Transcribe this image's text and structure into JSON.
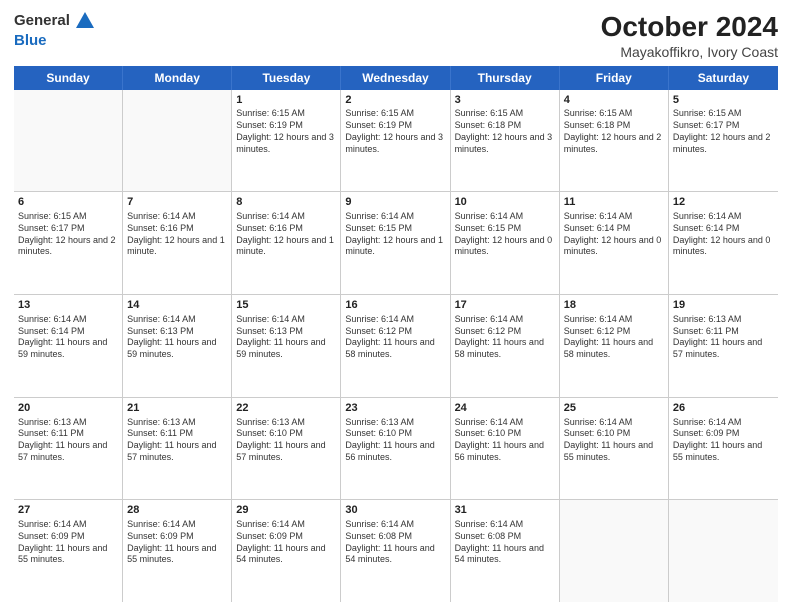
{
  "logo": {
    "general": "General",
    "blue": "Blue"
  },
  "title": "October 2024",
  "subtitle": "Mayakoffikro, Ivory Coast",
  "header_days": [
    "Sunday",
    "Monday",
    "Tuesday",
    "Wednesday",
    "Thursday",
    "Friday",
    "Saturday"
  ],
  "weeks": [
    [
      {
        "day": "",
        "sunrise": "",
        "sunset": "",
        "daylight": ""
      },
      {
        "day": "",
        "sunrise": "",
        "sunset": "",
        "daylight": ""
      },
      {
        "day": "1",
        "sunrise": "Sunrise: 6:15 AM",
        "sunset": "Sunset: 6:19 PM",
        "daylight": "Daylight: 12 hours and 3 minutes."
      },
      {
        "day": "2",
        "sunrise": "Sunrise: 6:15 AM",
        "sunset": "Sunset: 6:19 PM",
        "daylight": "Daylight: 12 hours and 3 minutes."
      },
      {
        "day": "3",
        "sunrise": "Sunrise: 6:15 AM",
        "sunset": "Sunset: 6:18 PM",
        "daylight": "Daylight: 12 hours and 3 minutes."
      },
      {
        "day": "4",
        "sunrise": "Sunrise: 6:15 AM",
        "sunset": "Sunset: 6:18 PM",
        "daylight": "Daylight: 12 hours and 2 minutes."
      },
      {
        "day": "5",
        "sunrise": "Sunrise: 6:15 AM",
        "sunset": "Sunset: 6:17 PM",
        "daylight": "Daylight: 12 hours and 2 minutes."
      }
    ],
    [
      {
        "day": "6",
        "sunrise": "Sunrise: 6:15 AM",
        "sunset": "Sunset: 6:17 PM",
        "daylight": "Daylight: 12 hours and 2 minutes."
      },
      {
        "day": "7",
        "sunrise": "Sunrise: 6:14 AM",
        "sunset": "Sunset: 6:16 PM",
        "daylight": "Daylight: 12 hours and 1 minute."
      },
      {
        "day": "8",
        "sunrise": "Sunrise: 6:14 AM",
        "sunset": "Sunset: 6:16 PM",
        "daylight": "Daylight: 12 hours and 1 minute."
      },
      {
        "day": "9",
        "sunrise": "Sunrise: 6:14 AM",
        "sunset": "Sunset: 6:15 PM",
        "daylight": "Daylight: 12 hours and 1 minute."
      },
      {
        "day": "10",
        "sunrise": "Sunrise: 6:14 AM",
        "sunset": "Sunset: 6:15 PM",
        "daylight": "Daylight: 12 hours and 0 minutes."
      },
      {
        "day": "11",
        "sunrise": "Sunrise: 6:14 AM",
        "sunset": "Sunset: 6:14 PM",
        "daylight": "Daylight: 12 hours and 0 minutes."
      },
      {
        "day": "12",
        "sunrise": "Sunrise: 6:14 AM",
        "sunset": "Sunset: 6:14 PM",
        "daylight": "Daylight: 12 hours and 0 minutes."
      }
    ],
    [
      {
        "day": "13",
        "sunrise": "Sunrise: 6:14 AM",
        "sunset": "Sunset: 6:14 PM",
        "daylight": "Daylight: 11 hours and 59 minutes."
      },
      {
        "day": "14",
        "sunrise": "Sunrise: 6:14 AM",
        "sunset": "Sunset: 6:13 PM",
        "daylight": "Daylight: 11 hours and 59 minutes."
      },
      {
        "day": "15",
        "sunrise": "Sunrise: 6:14 AM",
        "sunset": "Sunset: 6:13 PM",
        "daylight": "Daylight: 11 hours and 59 minutes."
      },
      {
        "day": "16",
        "sunrise": "Sunrise: 6:14 AM",
        "sunset": "Sunset: 6:12 PM",
        "daylight": "Daylight: 11 hours and 58 minutes."
      },
      {
        "day": "17",
        "sunrise": "Sunrise: 6:14 AM",
        "sunset": "Sunset: 6:12 PM",
        "daylight": "Daylight: 11 hours and 58 minutes."
      },
      {
        "day": "18",
        "sunrise": "Sunrise: 6:14 AM",
        "sunset": "Sunset: 6:12 PM",
        "daylight": "Daylight: 11 hours and 58 minutes."
      },
      {
        "day": "19",
        "sunrise": "Sunrise: 6:13 AM",
        "sunset": "Sunset: 6:11 PM",
        "daylight": "Daylight: 11 hours and 57 minutes."
      }
    ],
    [
      {
        "day": "20",
        "sunrise": "Sunrise: 6:13 AM",
        "sunset": "Sunset: 6:11 PM",
        "daylight": "Daylight: 11 hours and 57 minutes."
      },
      {
        "day": "21",
        "sunrise": "Sunrise: 6:13 AM",
        "sunset": "Sunset: 6:11 PM",
        "daylight": "Daylight: 11 hours and 57 minutes."
      },
      {
        "day": "22",
        "sunrise": "Sunrise: 6:13 AM",
        "sunset": "Sunset: 6:10 PM",
        "daylight": "Daylight: 11 hours and 57 minutes."
      },
      {
        "day": "23",
        "sunrise": "Sunrise: 6:13 AM",
        "sunset": "Sunset: 6:10 PM",
        "daylight": "Daylight: 11 hours and 56 minutes."
      },
      {
        "day": "24",
        "sunrise": "Sunrise: 6:14 AM",
        "sunset": "Sunset: 6:10 PM",
        "daylight": "Daylight: 11 hours and 56 minutes."
      },
      {
        "day": "25",
        "sunrise": "Sunrise: 6:14 AM",
        "sunset": "Sunset: 6:10 PM",
        "daylight": "Daylight: 11 hours and 55 minutes."
      },
      {
        "day": "26",
        "sunrise": "Sunrise: 6:14 AM",
        "sunset": "Sunset: 6:09 PM",
        "daylight": "Daylight: 11 hours and 55 minutes."
      }
    ],
    [
      {
        "day": "27",
        "sunrise": "Sunrise: 6:14 AM",
        "sunset": "Sunset: 6:09 PM",
        "daylight": "Daylight: 11 hours and 55 minutes."
      },
      {
        "day": "28",
        "sunrise": "Sunrise: 6:14 AM",
        "sunset": "Sunset: 6:09 PM",
        "daylight": "Daylight: 11 hours and 55 minutes."
      },
      {
        "day": "29",
        "sunrise": "Sunrise: 6:14 AM",
        "sunset": "Sunset: 6:09 PM",
        "daylight": "Daylight: 11 hours and 54 minutes."
      },
      {
        "day": "30",
        "sunrise": "Sunrise: 6:14 AM",
        "sunset": "Sunset: 6:08 PM",
        "daylight": "Daylight: 11 hours and 54 minutes."
      },
      {
        "day": "31",
        "sunrise": "Sunrise: 6:14 AM",
        "sunset": "Sunset: 6:08 PM",
        "daylight": "Daylight: 11 hours and 54 minutes."
      },
      {
        "day": "",
        "sunrise": "",
        "sunset": "",
        "daylight": ""
      },
      {
        "day": "",
        "sunrise": "",
        "sunset": "",
        "daylight": ""
      }
    ]
  ]
}
